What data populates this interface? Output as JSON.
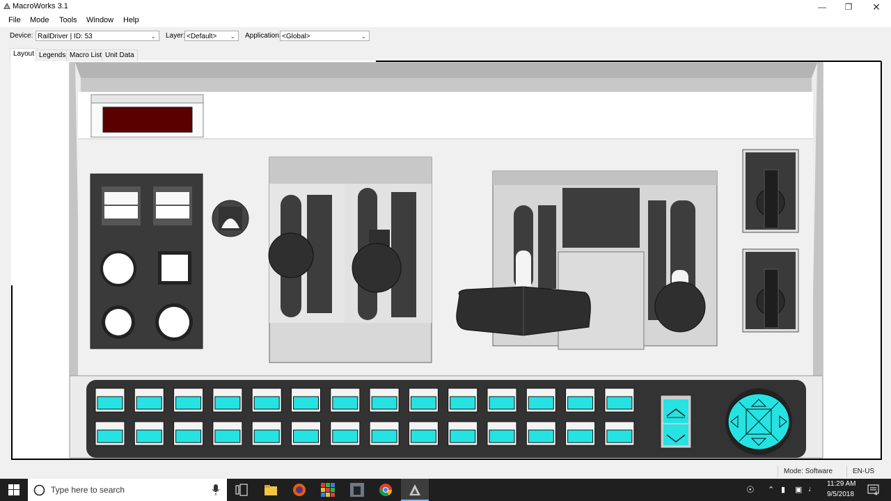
{
  "window": {
    "title": "MacroWorks 3.1"
  },
  "menu": [
    "File",
    "Mode",
    "Tools",
    "Window",
    "Help"
  ],
  "toolbar": {
    "device_label": "Device:",
    "device_value": "RailDriver | ID: 53",
    "layer_label": "Layer:",
    "layer_value": "<Default>",
    "application_label": "Application:",
    "application_value": "<Global>"
  },
  "tabs": [
    "Layout",
    "Legends",
    "Macro List",
    "Unit Data"
  ],
  "active_tab": "Layout",
  "statusbar": {
    "mode": "Mode: Software",
    "locale": "EN-US"
  },
  "taskbar": {
    "search_placeholder": "Type here to search",
    "time": "11:29 AM",
    "date": "9/5/2018",
    "notification_count": "4"
  },
  "colors": {
    "accent_cyan": "#25e3e3",
    "display_red": "#5a0000",
    "panel_dark": "#3a3a3a"
  }
}
